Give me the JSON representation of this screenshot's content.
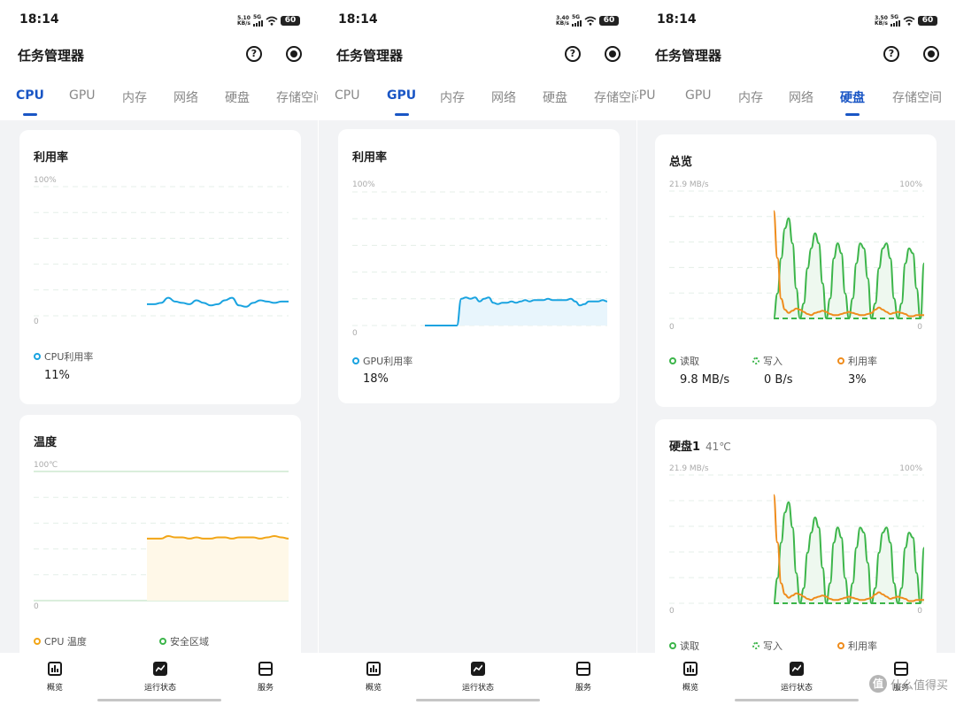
{
  "screens": [
    {
      "status": {
        "time": "18:14",
        "speed_value": "5.10",
        "speed_unit": "KB/s",
        "net": "5G",
        "battery": "60"
      },
      "title": "任务管理器",
      "help_glyph": "?",
      "tabs": [
        "CPU",
        "GPU",
        "内存",
        "网络",
        "硬盘",
        "存储空间"
      ],
      "active_tab": "CPU",
      "cards": [
        {
          "title": "利用率",
          "y_max": "100%",
          "y_min": "0",
          "legend": "CPU利用率",
          "value": "11%"
        },
        {
          "title": "温度",
          "y_max": "100℃",
          "y_min": "0",
          "legend": "CPU 温度",
          "legend2": "安全区域"
        }
      ],
      "nav": [
        "概览",
        "运行状态",
        "服务"
      ]
    },
    {
      "status": {
        "time": "18:14",
        "speed_value": "3.40",
        "speed_unit": "KB/s",
        "net": "5G",
        "battery": "60"
      },
      "title": "任务管理器",
      "help_glyph": "?",
      "tabs": [
        "CPU",
        "GPU",
        "内存",
        "网络",
        "硬盘",
        "存储空间"
      ],
      "active_tab": "GPU",
      "cards": [
        {
          "title": "利用率",
          "y_max": "100%",
          "y_min": "0",
          "legend": "GPU利用率",
          "value": "18%"
        }
      ],
      "nav": [
        "概览",
        "运行状态",
        "服务"
      ]
    },
    {
      "status": {
        "time": "18:14",
        "speed_value": "3.50",
        "speed_unit": "KB/s",
        "net": "5G",
        "battery": "60"
      },
      "title": "任务管理器",
      "help_glyph": "?",
      "tabs": [
        "CPU",
        "GPU",
        "内存",
        "网络",
        "硬盘",
        "存储空间"
      ],
      "active_tab": "硬盘",
      "cards": [
        {
          "title": "总览",
          "y_left_max": "21.9 MB/s",
          "y_right_max": "100%",
          "y_left_min": "0",
          "y_right_min": "0",
          "legend_read": "读取",
          "legend_write": "写入",
          "legend_util": "利用率",
          "value_read": "9.8 MB/s",
          "value_write": "0 B/s",
          "value_util": "3%"
        },
        {
          "title": "硬盘1",
          "subtitle": "41℃",
          "y_left_max": "21.9 MB/s",
          "y_right_max": "100%",
          "y_left_min": "0",
          "y_right_min": "0",
          "legend_read": "读取",
          "legend_write": "写入",
          "legend_util": "利用率"
        }
      ],
      "nav": [
        "概览",
        "运行状态",
        "服务"
      ]
    }
  ],
  "watermark": {
    "logo_glyph": "值",
    "text": "什么值得买"
  },
  "colors": {
    "accent": "#1a56c5",
    "cpu_line": "#1aa3e0",
    "temp_line": "#f2a516",
    "temp_fill": "#fff8e8",
    "safe": "#3cb54a",
    "read": "#3cb54a",
    "write": "#3cb54a",
    "util": "#ef8c1c",
    "card": "#ffffff",
    "bg": "#f2f3f5"
  },
  "chart_data": [
    {
      "type": "line",
      "screen": 1,
      "chart": "CPU利用率",
      "x": [
        0,
        1,
        2,
        3,
        4,
        5,
        6,
        7,
        8,
        9,
        10,
        11,
        12,
        13,
        14,
        15,
        16,
        17,
        18,
        19,
        20
      ],
      "values": [
        9,
        9,
        10,
        14,
        11,
        10,
        9,
        12,
        10,
        8,
        9,
        12,
        14,
        8,
        7,
        10,
        12,
        11,
        10,
        11,
        11
      ],
      "ylim": [
        0,
        100
      ]
    },
    {
      "type": "area",
      "screen": 1,
      "chart": "CPU 温度",
      "x": [
        0,
        1,
        2,
        3,
        4,
        5,
        6,
        7,
        8,
        9,
        10,
        11,
        12,
        13,
        14,
        15,
        16,
        17,
        18,
        19,
        20
      ],
      "values": [
        48,
        48,
        48,
        50,
        49,
        49,
        48,
        49,
        48,
        48,
        49,
        49,
        48,
        49,
        49,
        49,
        48,
        49,
        50,
        49,
        48
      ],
      "ylim": [
        0,
        100
      ]
    },
    {
      "type": "area",
      "screen": 2,
      "chart": "GPU利用率",
      "x": [
        0,
        1,
        2,
        3,
        4,
        5,
        6,
        7,
        8,
        9,
        10,
        11,
        12,
        13,
        14,
        15,
        16,
        17,
        18,
        19,
        20,
        21,
        22,
        23,
        24,
        25,
        26,
        27,
        28,
        29,
        30,
        31,
        32,
        33,
        34,
        35,
        36,
        37,
        38,
        39,
        40
      ],
      "values": [
        0,
        0,
        0,
        0,
        0,
        0,
        0,
        0,
        20,
        21,
        20,
        21,
        18,
        20,
        21,
        17,
        16,
        17,
        17,
        18,
        17,
        18,
        19,
        18,
        19,
        19,
        19,
        20,
        19,
        19,
        19,
        19,
        20,
        18,
        15,
        16,
        18,
        18,
        18,
        19,
        18
      ],
      "ylim": [
        0,
        100
      ]
    },
    {
      "type": "line",
      "screen": 3,
      "chart": "总览",
      "x": [
        0,
        1,
        2,
        3,
        4,
        5,
        6,
        7,
        8,
        9,
        10,
        11,
        12,
        13,
        14,
        15,
        16,
        17,
        18,
        19,
        20,
        21,
        22,
        23,
        24,
        25,
        26,
        27,
        28,
        29,
        30,
        31,
        32,
        33,
        34,
        35,
        36,
        37,
        38,
        39,
        40
      ],
      "series": [
        {
          "name": "读取",
          "values": [
            0,
            5,
            12,
            18,
            20,
            15,
            6,
            0,
            3,
            10,
            14,
            17,
            15,
            7,
            0,
            4,
            12,
            15,
            13,
            5,
            0,
            4,
            11,
            15,
            14,
            8,
            0,
            3,
            10,
            14,
            15,
            12,
            4,
            0,
            3,
            11,
            14,
            13,
            6,
            0,
            11
          ]
        },
        {
          "name": "利用率",
          "values": [
            98,
            55,
            18,
            8,
            5,
            7,
            9,
            8,
            6,
            4,
            3,
            5,
            6,
            7,
            6,
            4,
            3,
            3,
            4,
            5,
            6,
            5,
            4,
            3,
            3,
            4,
            5,
            8,
            10,
            8,
            6,
            4,
            5,
            6,
            5,
            4,
            2,
            2,
            3,
            3,
            3
          ]
        }
      ],
      "ylim_left": [
        0,
        21.9
      ],
      "ylim_right": [
        0,
        100
      ]
    },
    {
      "type": "line",
      "screen": 3,
      "chart": "硬盘1",
      "x": [
        0,
        1,
        2,
        3,
        4,
        5,
        6,
        7,
        8,
        9,
        10,
        11,
        12,
        13,
        14,
        15,
        16,
        17,
        18,
        19,
        20,
        21,
        22,
        23,
        24,
        25,
        26,
        27,
        28,
        29,
        30,
        31,
        32,
        33,
        34,
        35,
        36,
        37,
        38,
        39,
        40
      ],
      "series": [
        {
          "name": "读取",
          "values": [
            0,
            5,
            12,
            18,
            20,
            15,
            6,
            0,
            3,
            10,
            14,
            17,
            15,
            7,
            0,
            4,
            12,
            15,
            13,
            5,
            0,
            4,
            11,
            15,
            14,
            8,
            0,
            3,
            10,
            14,
            15,
            12,
            4,
            0,
            3,
            11,
            14,
            13,
            6,
            0,
            11
          ]
        },
        {
          "name": "利用率",
          "values": [
            98,
            55,
            18,
            8,
            5,
            7,
            9,
            8,
            6,
            4,
            3,
            5,
            6,
            7,
            6,
            4,
            3,
            3,
            4,
            5,
            6,
            5,
            4,
            3,
            3,
            4,
            5,
            8,
            10,
            8,
            6,
            4,
            5,
            6,
            5,
            4,
            2,
            2,
            3,
            3,
            3
          ]
        }
      ],
      "ylim_left": [
        0,
        21.9
      ],
      "ylim_right": [
        0,
        100
      ]
    }
  ]
}
